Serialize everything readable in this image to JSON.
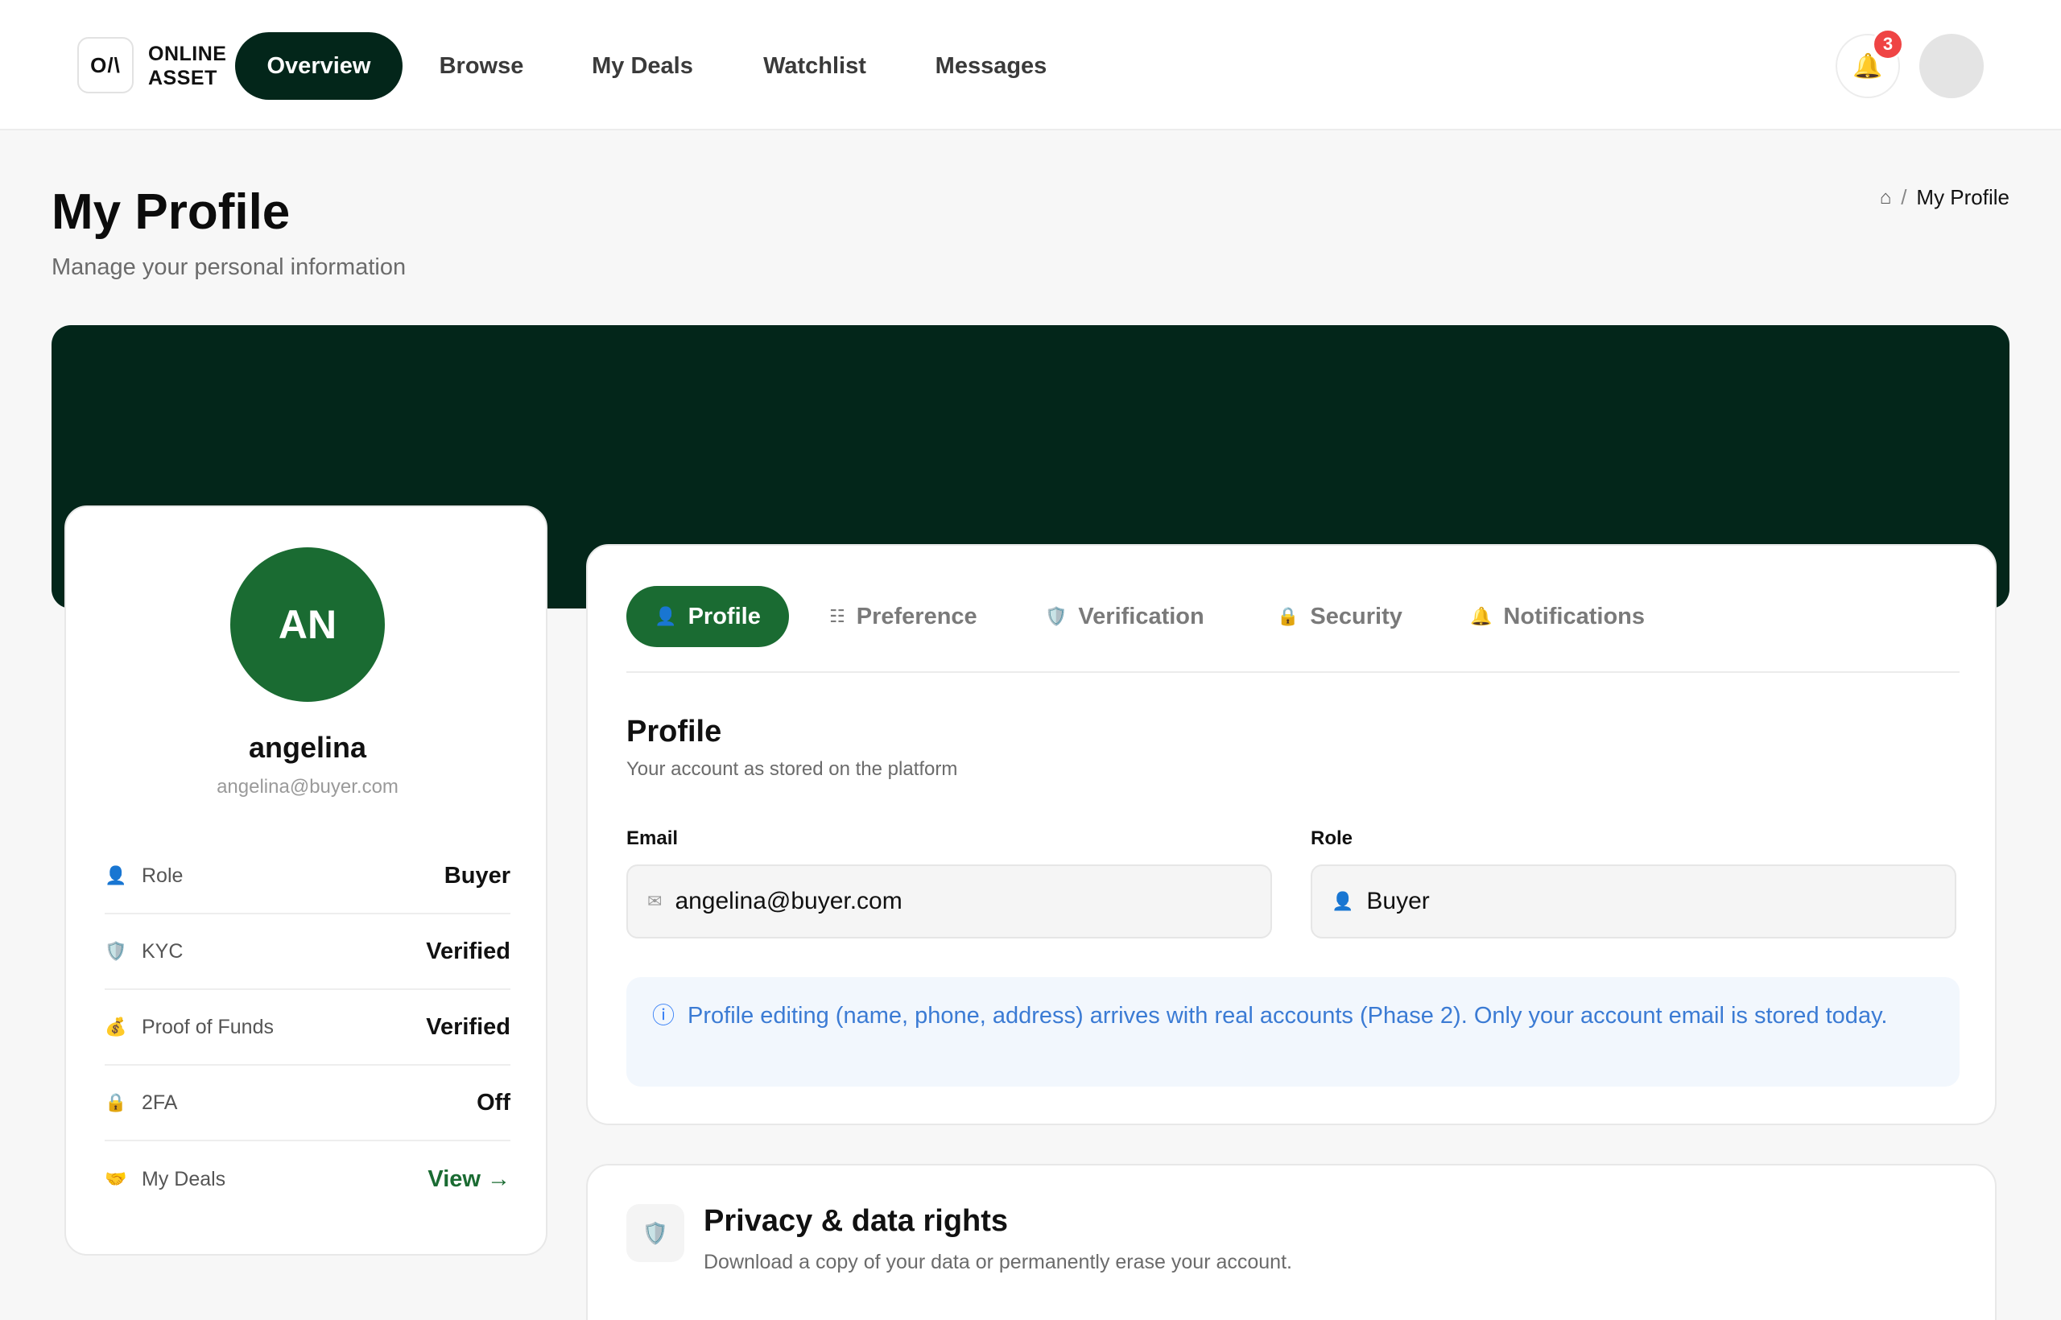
{
  "app": {
    "logo_mark": "O/\\",
    "logo_line1": "ONLINE",
    "logo_line2": "ASSET"
  },
  "nav": {
    "items": [
      {
        "label": "Overview",
        "active": true
      },
      {
        "label": "Browse",
        "active": false
      },
      {
        "label": "My Deals",
        "active": false
      },
      {
        "label": "Watchlist",
        "active": false
      },
      {
        "label": "Messages",
        "active": false
      }
    ],
    "notification_count": "3",
    "notification_icon": "bell-icon"
  },
  "header": {
    "title": "My Profile",
    "subtitle": "Manage your personal information",
    "breadcrumb_current": "My Profile",
    "breadcrumb_home_icon": "⌂",
    "breadcrumb_separator": "/"
  },
  "profile_card": {
    "initials": "AN",
    "name": "angelina",
    "email": "angelina@buyer.com",
    "rows": [
      {
        "icon": "👤",
        "label": "Role",
        "value": "Buyer"
      },
      {
        "icon": "🛡️",
        "label": "KYC",
        "value": "Verified"
      },
      {
        "icon": "💰",
        "label": "Proof of Funds",
        "value": "Verified"
      },
      {
        "icon": "🔒",
        "label": "2FA",
        "value": "Off"
      },
      {
        "icon": "🤝",
        "label": "My Deals",
        "value": "View →"
      }
    ]
  },
  "tabs": [
    {
      "icon": "👤",
      "label": "Profile",
      "active": true
    },
    {
      "icon": "☷",
      "label": "Preference",
      "active": false
    },
    {
      "icon": "🛡️",
      "label": "Verification",
      "active": false
    },
    {
      "icon": "🔒",
      "label": "Security",
      "active": false
    },
    {
      "icon": "🔔",
      "label": "Notifications",
      "active": false
    }
  ],
  "profile_section": {
    "title": "Profile",
    "subtitle": "Your account as stored on the platform",
    "email_label": "Email",
    "email_value": "angelina@buyer.com",
    "email_icon": "✉",
    "role_label": "Role",
    "role_value": "Buyer",
    "role_icon": "👤",
    "notice_icon": "ⓘ",
    "notice": "Profile editing (name, phone, address) arrives with real accounts (Phase 2). Only your account email is stored today."
  },
  "privacy": {
    "icon": "🛡️",
    "title": "Privacy & data rights",
    "subtitle": "Download a copy of your data or permanently erase your account."
  },
  "colors": {
    "brand_dark": "#03261a",
    "brand_green": "#1a6b32",
    "badge_red": "#ef4444",
    "notice_blue": "#3b7bd4"
  }
}
